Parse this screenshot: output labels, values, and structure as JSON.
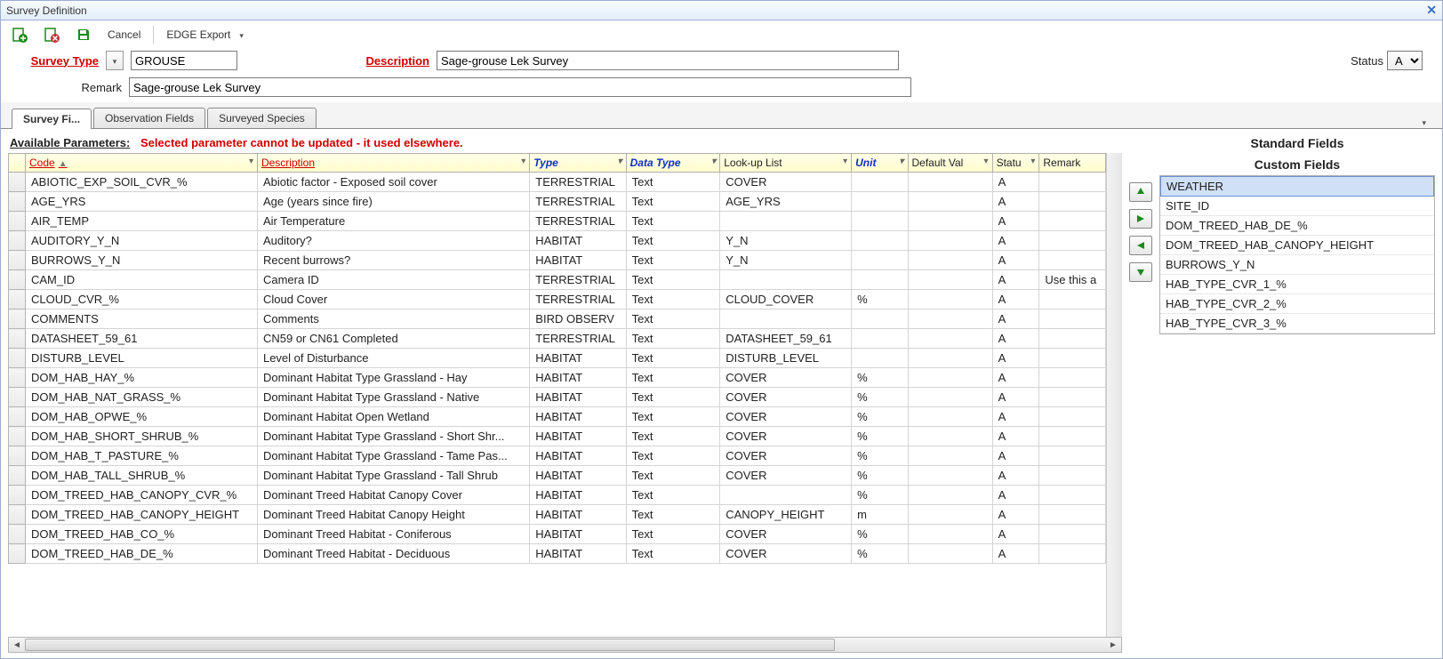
{
  "window": {
    "title": "Survey Definition"
  },
  "toolbar": {
    "cancel": "Cancel",
    "edge_export": "EDGE Export"
  },
  "form": {
    "survey_type_label": "Survey Type",
    "survey_type_value": "GROUSE",
    "description_label": "Description",
    "description_value": "Sage-grouse Lek Survey",
    "remark_label": "Remark",
    "remark_value": "Sage-grouse Lek Survey",
    "status_label": "Status",
    "status_value": "A"
  },
  "tabs": {
    "survey_fields": "Survey Fi...",
    "observation_fields": "Observation Fields",
    "surveyed_species": "Surveyed Species"
  },
  "params": {
    "heading": "Available Parameters:",
    "warning": "Selected parameter cannot be updated - it used elsewhere."
  },
  "columns": {
    "code": "Code",
    "description": "Description",
    "type": "Type",
    "data_type": "Data Type",
    "lookup_list": "Look-up List",
    "unit": "Unit",
    "default_val": "Default Val",
    "status": "Statu",
    "remark": "Remark"
  },
  "rows": [
    {
      "code": "ABIOTIC_EXP_SOIL_CVR_%",
      "desc": "Abiotic factor - Exposed soil cover",
      "type": "TERRESTRIAL",
      "dtype": "Text",
      "lookup": "COVER",
      "unit": "",
      "def": "",
      "status": "A",
      "remark": ""
    },
    {
      "code": "AGE_YRS",
      "desc": "Age (years since fire)",
      "type": "TERRESTRIAL",
      "dtype": "Text",
      "lookup": "AGE_YRS",
      "unit": "",
      "def": "",
      "status": "A",
      "remark": ""
    },
    {
      "code": "AIR_TEMP",
      "desc": "Air Temperature",
      "type": "TERRESTRIAL",
      "dtype": "Text",
      "lookup": "",
      "unit": "",
      "def": "",
      "status": "A",
      "remark": ""
    },
    {
      "code": "AUDITORY_Y_N",
      "desc": "Auditory?",
      "type": "HABITAT",
      "dtype": "Text",
      "lookup": "Y_N",
      "unit": "",
      "def": "",
      "status": "A",
      "remark": ""
    },
    {
      "code": "BURROWS_Y_N",
      "desc": "Recent burrows?",
      "type": "HABITAT",
      "dtype": "Text",
      "lookup": "Y_N",
      "unit": "",
      "def": "",
      "status": "A",
      "remark": ""
    },
    {
      "code": "CAM_ID",
      "desc": "Camera ID",
      "type": "TERRESTRIAL",
      "dtype": "Text",
      "lookup": "",
      "unit": "",
      "def": "",
      "status": "A",
      "remark": "Use this a"
    },
    {
      "code": "CLOUD_CVR_%",
      "desc": "Cloud Cover",
      "type": "TERRESTRIAL",
      "dtype": "Text",
      "lookup": "CLOUD_COVER",
      "unit": "%",
      "def": "",
      "status": "A",
      "remark": ""
    },
    {
      "code": "COMMENTS",
      "desc": "Comments",
      "type": "BIRD OBSERV",
      "dtype": "Text",
      "lookup": "",
      "unit": "",
      "def": "",
      "status": "A",
      "remark": ""
    },
    {
      "code": "DATASHEET_59_61",
      "desc": "CN59 or CN61 Completed",
      "type": "TERRESTRIAL",
      "dtype": "Text",
      "lookup": "DATASHEET_59_61",
      "unit": "",
      "def": "",
      "status": "A",
      "remark": ""
    },
    {
      "code": "DISTURB_LEVEL",
      "desc": "Level of Disturbance",
      "type": "HABITAT",
      "dtype": "Text",
      "lookup": "DISTURB_LEVEL",
      "unit": "",
      "def": "",
      "status": "A",
      "remark": ""
    },
    {
      "code": "DOM_HAB_HAY_%",
      "desc": "Dominant Habitat Type Grassland - Hay",
      "type": "HABITAT",
      "dtype": "Text",
      "lookup": "COVER",
      "unit": "%",
      "def": "",
      "status": "A",
      "remark": ""
    },
    {
      "code": "DOM_HAB_NAT_GRASS_%",
      "desc": "Dominant Habitat Type Grassland - Native",
      "type": "HABITAT",
      "dtype": "Text",
      "lookup": "COVER",
      "unit": "%",
      "def": "",
      "status": "A",
      "remark": ""
    },
    {
      "code": "DOM_HAB_OPWE_%",
      "desc": "Dominant Habitat Open Wetland",
      "type": "HABITAT",
      "dtype": "Text",
      "lookup": "COVER",
      "unit": "%",
      "def": "",
      "status": "A",
      "remark": ""
    },
    {
      "code": "DOM_HAB_SHORT_SHRUB_%",
      "desc": "Dominant Habitat Type Grassland - Short Shr...",
      "type": "HABITAT",
      "dtype": "Text",
      "lookup": "COVER",
      "unit": "%",
      "def": "",
      "status": "A",
      "remark": ""
    },
    {
      "code": "DOM_HAB_T_PASTURE_%",
      "desc": "Dominant Habitat Type Grassland - Tame Pas...",
      "type": "HABITAT",
      "dtype": "Text",
      "lookup": "COVER",
      "unit": "%",
      "def": "",
      "status": "A",
      "remark": ""
    },
    {
      "code": "DOM_HAB_TALL_SHRUB_%",
      "desc": "Dominant Habitat Type Grassland - Tall Shrub",
      "type": "HABITAT",
      "dtype": "Text",
      "lookup": "COVER",
      "unit": "%",
      "def": "",
      "status": "A",
      "remark": ""
    },
    {
      "code": "DOM_TREED_HAB_CANOPY_CVR_%",
      "desc": "Dominant Treed Habitat Canopy Cover",
      "type": "HABITAT",
      "dtype": "Text",
      "lookup": "",
      "unit": "%",
      "def": "",
      "status": "A",
      "remark": ""
    },
    {
      "code": "DOM_TREED_HAB_CANOPY_HEIGHT",
      "desc": "Dominant Treed Habitat Canopy Height",
      "type": "HABITAT",
      "dtype": "Text",
      "lookup": "CANOPY_HEIGHT",
      "unit": "m",
      "def": "",
      "status": "A",
      "remark": ""
    },
    {
      "code": "DOM_TREED_HAB_CO_%",
      "desc": "Dominant Treed Habitat - Coniferous",
      "type": "HABITAT",
      "dtype": "Text",
      "lookup": "COVER",
      "unit": "%",
      "def": "",
      "status": "A",
      "remark": ""
    },
    {
      "code": "DOM_TREED_HAB_DE_%",
      "desc": "Dominant Treed Habitat - Deciduous",
      "type": "HABITAT",
      "dtype": "Text",
      "lookup": "COVER",
      "unit": "%",
      "def": "",
      "status": "A",
      "remark": ""
    }
  ],
  "right": {
    "standard_fields": "Standard Fields",
    "custom_fields": "Custom Fields",
    "items": [
      "WEATHER",
      "SITE_ID",
      "DOM_TREED_HAB_DE_%",
      "DOM_TREED_HAB_CANOPY_HEIGHT",
      "BURROWS_Y_N",
      "HAB_TYPE_CVR_1_%",
      "HAB_TYPE_CVR_2_%",
      "HAB_TYPE_CVR_3_%"
    ],
    "selected_index": 0
  }
}
